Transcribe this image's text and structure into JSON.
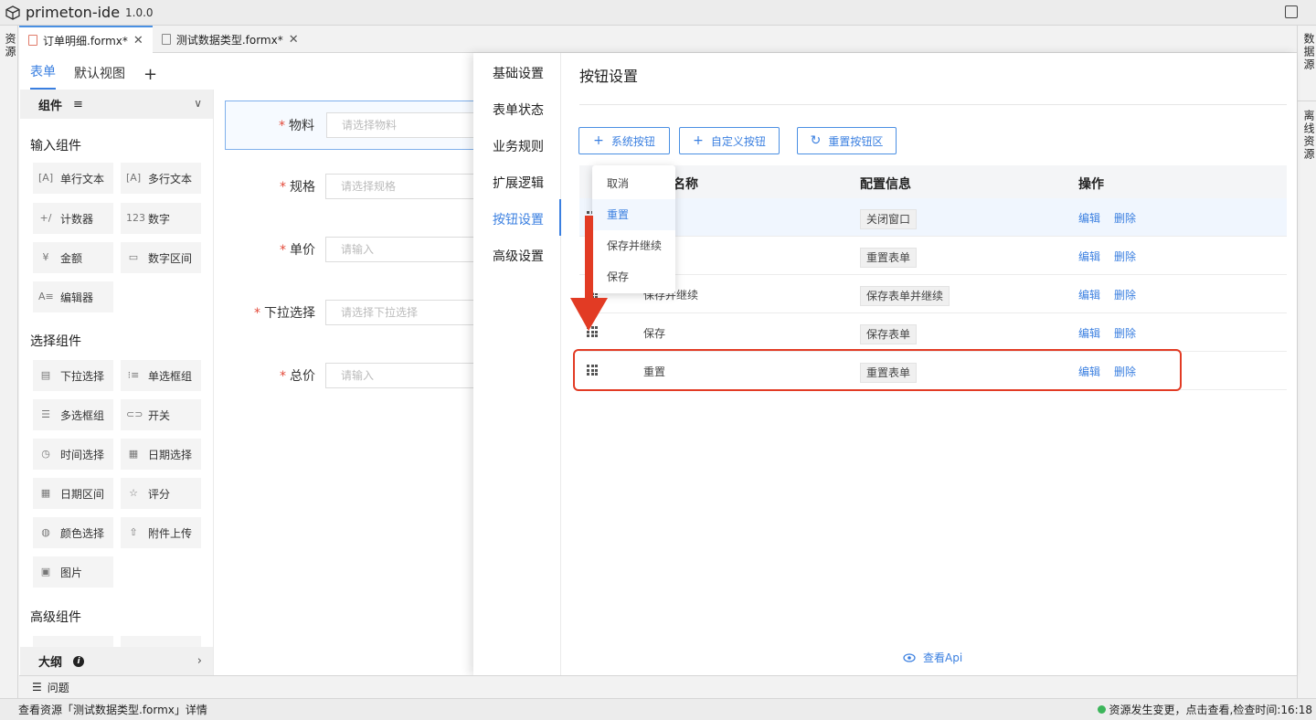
{
  "app": {
    "name": "primeton-ide",
    "version": "1.0.0"
  },
  "left_rail": {
    "label": "资源"
  },
  "right_rail": {
    "items": [
      "数据源",
      "离线资源"
    ]
  },
  "editor_tabs": [
    {
      "label": "订单明细.formx*"
    },
    {
      "label": "测试数据类型.formx*"
    }
  ],
  "view_tabs": {
    "form": "表单",
    "default_view": "默认视图",
    "add": "+"
  },
  "components": {
    "header": "组件",
    "sections": [
      {
        "title": "输入组件",
        "items": [
          "单行文本",
          "多行文本",
          "计数器",
          "数字",
          "金额",
          "数字区间",
          "编辑器"
        ]
      },
      {
        "title": "选择组件",
        "items": [
          "下拉选择",
          "单选框组",
          "多选框组",
          "开关",
          "时间选择",
          "日期选择",
          "日期区间",
          "评分",
          "颜色选择",
          "附件上传",
          "图片"
        ]
      },
      {
        "title": "高级组件",
        "items": []
      }
    ],
    "outline": "大纲"
  },
  "form_fields": [
    {
      "label": "物料",
      "placeholder": "请选择物料",
      "required": true
    },
    {
      "label": "规格",
      "placeholder": "请选择规格",
      "required": true
    },
    {
      "label": "单价",
      "placeholder": "请输入",
      "required": true
    },
    {
      "label": "下拉选择",
      "placeholder": "请选择下拉选择",
      "required": true
    },
    {
      "label": "总价",
      "placeholder": "请输入",
      "required": true
    }
  ],
  "settings_nav": [
    "基础设置",
    "表单状态",
    "业务规则",
    "扩展逻辑",
    "按钮设置",
    "高级设置"
  ],
  "settings_nav_active": "按钮设置",
  "panel": {
    "title": "按钮设置",
    "buttons": {
      "system": "系统按钮",
      "custom": "自定义按钮",
      "reset": "重置按钮区"
    },
    "table_headers": {
      "name": "名称",
      "config": "配置信息",
      "actions": "操作"
    },
    "rows": [
      {
        "name": "",
        "config": "关闭窗口",
        "edit": "编辑",
        "delete": "删除"
      },
      {
        "name": "",
        "config": "重置表单",
        "edit": "编辑",
        "delete": "删除"
      },
      {
        "name": "保存并继续",
        "config": "保存表单并继续",
        "edit": "编辑",
        "delete": "删除"
      },
      {
        "name": "保存",
        "config": "保存表单",
        "edit": "编辑",
        "delete": "删除"
      },
      {
        "name": "重置",
        "config": "重置表单",
        "edit": "编辑",
        "delete": "删除"
      }
    ],
    "view_api": "查看Api"
  },
  "dropdown": {
    "items": [
      "取消",
      "重置",
      "保存并继续",
      "保存"
    ],
    "active": "重置"
  },
  "problems": {
    "label": "问题"
  },
  "status": {
    "left": "查看资源「测试数据类型.formx」详情",
    "right": "资源发生变更，点击查看,检查时间:16:18"
  },
  "colors": {
    "accent": "#3a7fe0",
    "annotation": "#e23b24",
    "status_ok": "#3cb55a"
  }
}
